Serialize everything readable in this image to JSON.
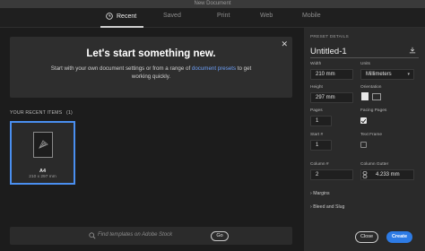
{
  "window": {
    "title": "New Document"
  },
  "tabs": [
    {
      "label": "Recent",
      "active": true
    },
    {
      "label": "Saved"
    },
    {
      "label": "Print"
    },
    {
      "label": "Web"
    },
    {
      "label": "Mobile"
    }
  ],
  "hero": {
    "heading": "Let's start something new.",
    "text_before": "Start with your own document settings or from a range of ",
    "link": "document presets",
    "text_after": " to get working quickly."
  },
  "recent": {
    "label": "YOUR RECENT ITEMS",
    "count": "(1)",
    "items": [
      {
        "name": "A4",
        "size": "210 x 297 mm"
      }
    ]
  },
  "search": {
    "placeholder": "Find templates on Adobe Stock",
    "go_label": "Go"
  },
  "preset": {
    "header": "PRESET DETAILS",
    "name": "Untitled-1",
    "width_label": "Width",
    "width_value": "210 mm",
    "units_label": "Units",
    "units_value": "Millimeters",
    "height_label": "Height",
    "height_value": "297 mm",
    "orientation_label": "Orientation",
    "pages_label": "Pages",
    "pages_value": "1",
    "facing_pages_label": "Facing Pages",
    "facing_pages_checked": true,
    "start_label": "Start #",
    "start_value": "1",
    "text_frame_label": "Text Frame",
    "text_frame_checked": false,
    "column_count_label": "Column #",
    "column_count_value": "2",
    "column_gutter_label": "Column Gutter",
    "column_gutter_value": "4.233 mm",
    "margins_label": "Margins",
    "bleed_label": "Bleed and Slug"
  },
  "actions": {
    "close": "Close",
    "create": "Create"
  },
  "colors": {
    "accent": "#2d7be5",
    "selection": "#4a8ff0",
    "link": "#6d9ef5"
  }
}
